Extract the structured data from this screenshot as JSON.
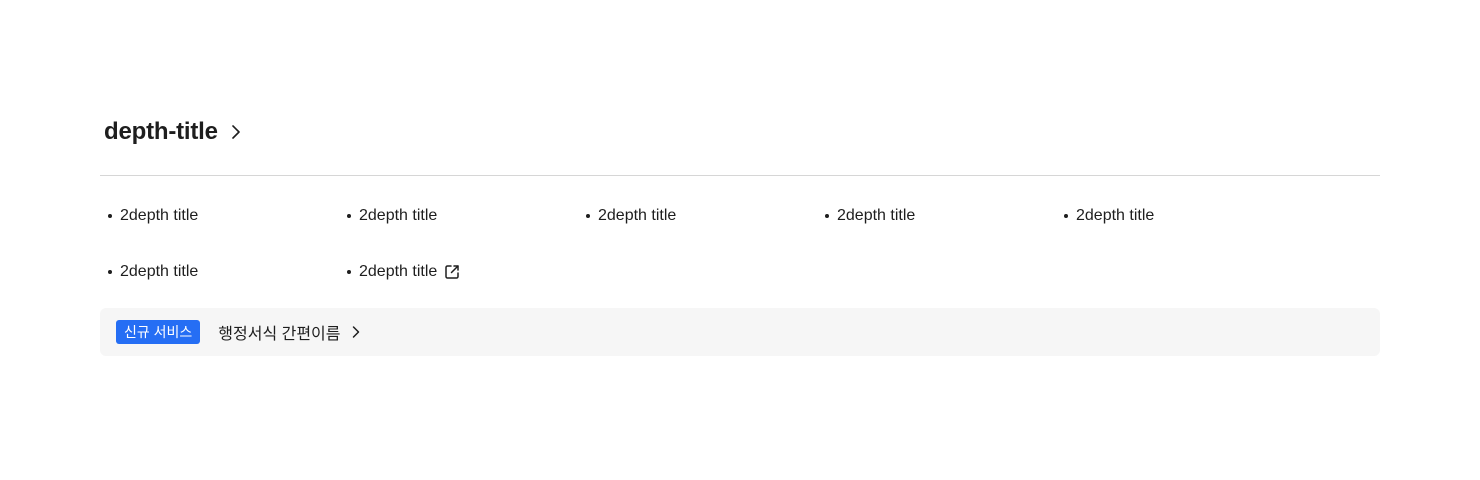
{
  "menu": {
    "title": "depth-title",
    "items": [
      {
        "label": "2depth title",
        "external": false
      },
      {
        "label": "2depth title",
        "external": false
      },
      {
        "label": "2depth title",
        "external": false
      },
      {
        "label": "2depth title",
        "external": false
      },
      {
        "label": "2depth title",
        "external": false
      },
      {
        "label": "2depth title",
        "external": false
      },
      {
        "label": "2depth title",
        "external": true
      }
    ]
  },
  "service": {
    "badge": "신규 서비스",
    "link_label": "행정서식 간편이름"
  },
  "colors": {
    "badge_bg": "#256ef4",
    "bar_bg": "#f6f6f6",
    "divider": "#d6d6d6",
    "text": "#1e1e1e"
  },
  "icons": {
    "title_chevron": "chevron-right-icon",
    "bullet": "bullet-dot-icon",
    "external": "external-link-icon",
    "service_chevron": "chevron-right-icon"
  }
}
